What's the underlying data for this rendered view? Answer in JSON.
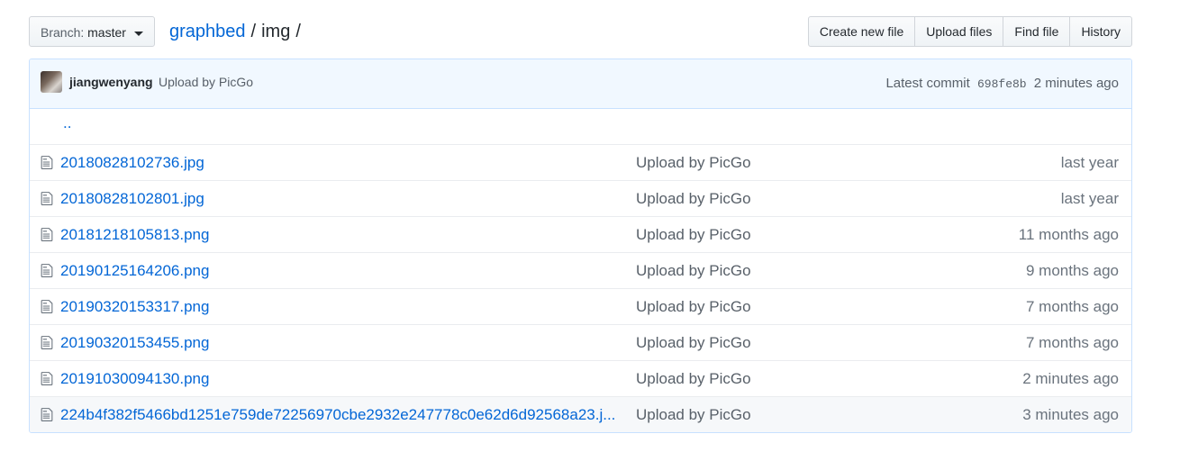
{
  "toolbar": {
    "branch_prefix": "Branch:",
    "branch_name": "master",
    "breadcrumb_root": "graphbed",
    "breadcrumb_sep1": "/",
    "breadcrumb_dir": "img",
    "breadcrumb_sep2": "/",
    "buttons": [
      "Create new file",
      "Upload files",
      "Find file",
      "History"
    ]
  },
  "commit": {
    "author": "jiangwenyang",
    "message": "Upload by PicGo",
    "latest_label": "Latest commit",
    "sha": "698fe8b",
    "age": "2 minutes ago"
  },
  "parent_link": "..",
  "files": [
    {
      "name": "20180828102736.jpg",
      "message": "Upload by PicGo",
      "age": "last year"
    },
    {
      "name": "20180828102801.jpg",
      "message": "Upload by PicGo",
      "age": "last year"
    },
    {
      "name": "20181218105813.png",
      "message": "Upload by PicGo",
      "age": "11 months ago"
    },
    {
      "name": "20190125164206.png",
      "message": "Upload by PicGo",
      "age": "9 months ago"
    },
    {
      "name": "20190320153317.png",
      "message": "Upload by PicGo",
      "age": "7 months ago"
    },
    {
      "name": "20190320153455.png",
      "message": "Upload by PicGo",
      "age": "7 months ago"
    },
    {
      "name": "20191030094130.png",
      "message": "Upload by PicGo",
      "age": "2 minutes ago"
    },
    {
      "name": "224b4f382f5466bd1251e759de72256970cbe2932e247778c0e62d6d92568a23.j...",
      "message": "Upload by PicGo",
      "age": "3 minutes ago"
    }
  ]
}
